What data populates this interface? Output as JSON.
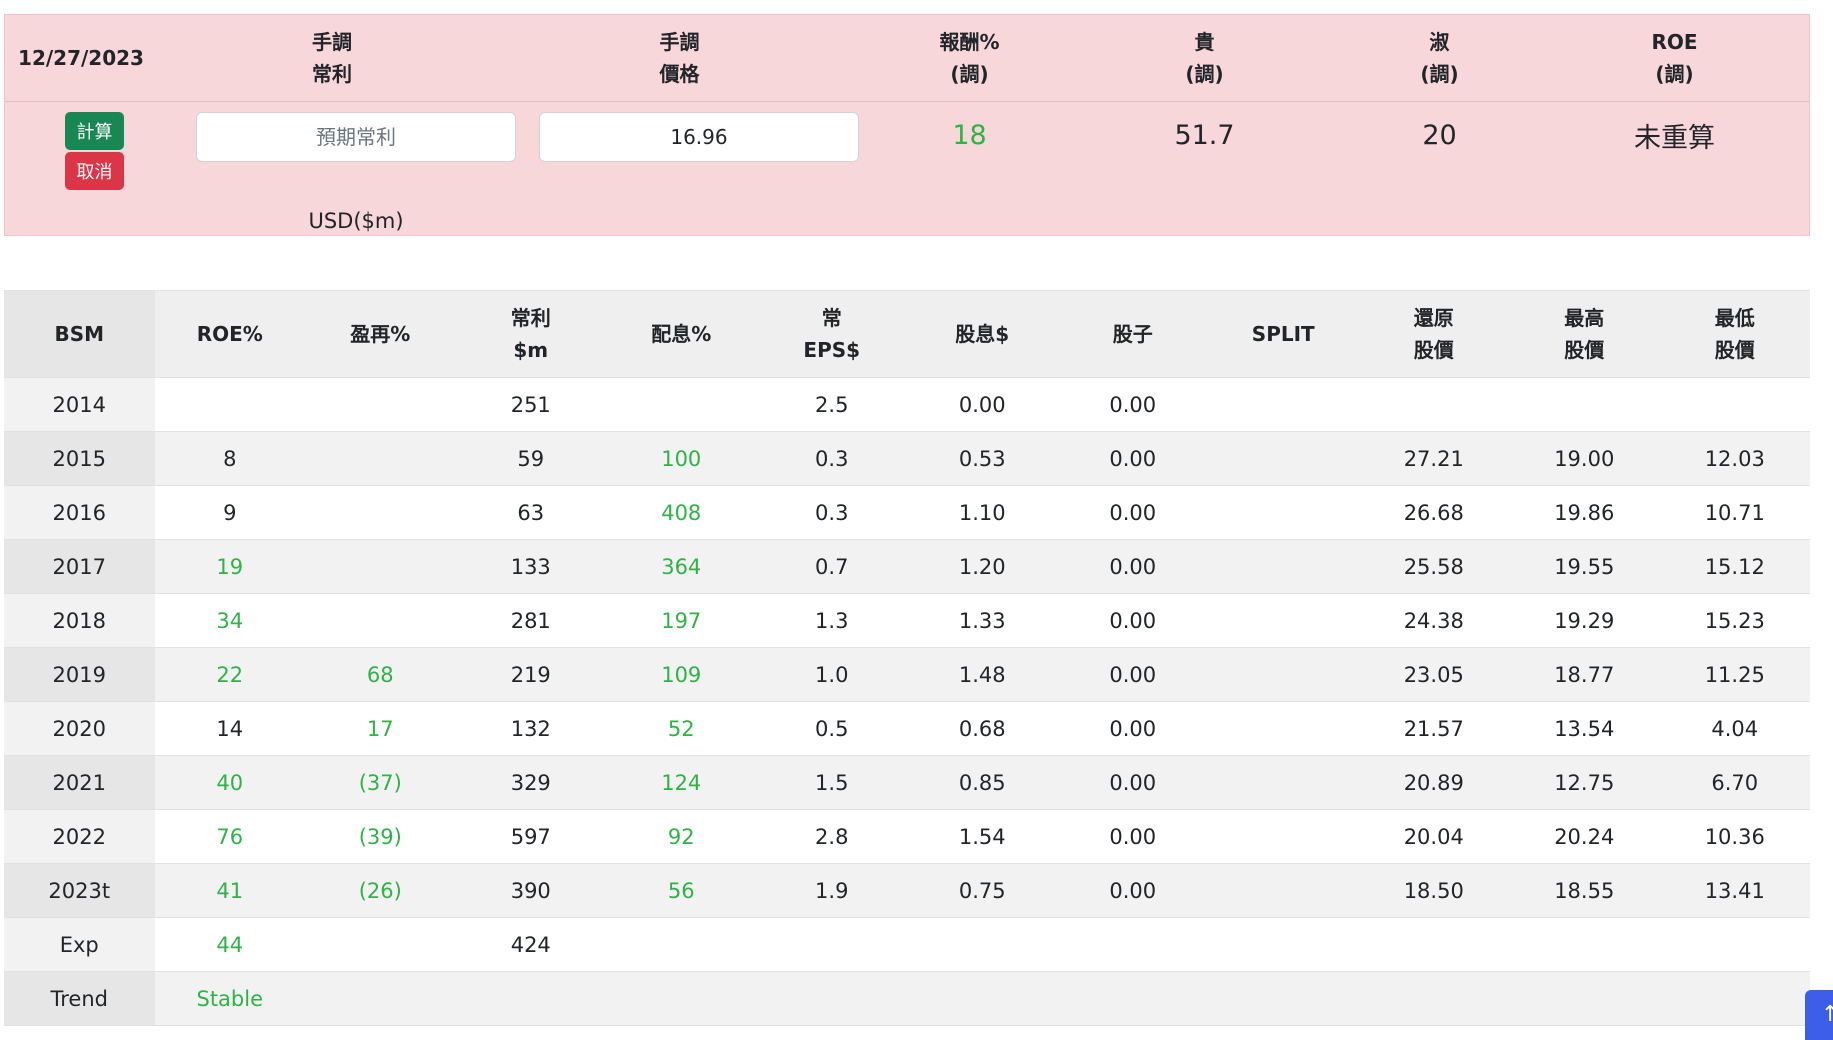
{
  "calc": {
    "headers": {
      "date": "12/27/2023",
      "adj_profit": [
        "手調",
        "常利"
      ],
      "adj_price": [
        "手調",
        "價格"
      ],
      "return": [
        "報酬%",
        "(調)"
      ],
      "expensive": [
        "貴",
        "(調)"
      ],
      "fair": [
        "淑",
        "(調)"
      ],
      "roe": [
        "ROE",
        "(調)"
      ]
    },
    "calc_button": "計算",
    "cancel_button": "取消",
    "profit_placeholder": "預期常利",
    "price_value": "16.96",
    "unit": "USD($m)",
    "return_value": "18",
    "expensive_value": "51.7",
    "fair_value": "20",
    "roe_value": "未重算"
  },
  "table": {
    "headers": [
      [
        "BSM"
      ],
      [
        "ROE%"
      ],
      [
        "盈再%"
      ],
      [
        "常利",
        "$m"
      ],
      [
        "配息%"
      ],
      [
        "常",
        "EPS$"
      ],
      [
        "股息$"
      ],
      [
        "股子"
      ],
      [
        "SPLIT"
      ],
      [
        "還原",
        "股價"
      ],
      [
        "最高",
        "股價"
      ],
      [
        "最低",
        "股價"
      ]
    ],
    "rows": [
      [
        "2014",
        "",
        "",
        "251",
        "",
        "2.5",
        "0.00",
        "0.00",
        "",
        "",
        "",
        ""
      ],
      [
        "2015",
        "8",
        "",
        "59",
        "100",
        "0.3",
        "0.53",
        "0.00",
        "",
        "27.21",
        "19.00",
        "12.03"
      ],
      [
        "2016",
        "9",
        "",
        "63",
        "408",
        "0.3",
        "1.10",
        "0.00",
        "",
        "26.68",
        "19.86",
        "10.71"
      ],
      [
        "2017",
        "19",
        "",
        "133",
        "364",
        "0.7",
        "1.20",
        "0.00",
        "",
        "25.58",
        "19.55",
        "15.12"
      ],
      [
        "2018",
        "34",
        "",
        "281",
        "197",
        "1.3",
        "1.33",
        "0.00",
        "",
        "24.38",
        "19.29",
        "15.23"
      ],
      [
        "2019",
        "22",
        "68",
        "219",
        "109",
        "1.0",
        "1.48",
        "0.00",
        "",
        "23.05",
        "18.77",
        "11.25"
      ],
      [
        "2020",
        "14",
        "17",
        "132",
        "52",
        "0.5",
        "0.68",
        "0.00",
        "",
        "21.57",
        "13.54",
        "4.04"
      ],
      [
        "2021",
        "40",
        "(37)",
        "329",
        "124",
        "1.5",
        "0.85",
        "0.00",
        "",
        "20.89",
        "12.75",
        "6.70"
      ],
      [
        "2022",
        "76",
        "(39)",
        "597",
        "92",
        "2.8",
        "1.54",
        "0.00",
        "",
        "20.04",
        "20.24",
        "10.36"
      ],
      [
        "2023t",
        "41",
        "(26)",
        "390",
        "56",
        "1.9",
        "0.75",
        "0.00",
        "",
        "18.50",
        "18.55",
        "13.41"
      ],
      [
        "Exp",
        "44",
        "",
        "424",
        "",
        "",
        "",
        "",
        "",
        "",
        "",
        ""
      ],
      [
        "Trend",
        "Stable",
        "",
        "",
        "",
        "",
        "",
        "",
        "",
        "",
        "",
        ""
      ]
    ],
    "green_cells": [
      [
        1,
        4
      ],
      [
        2,
        4
      ],
      [
        3,
        1
      ],
      [
        3,
        4
      ],
      [
        4,
        1
      ],
      [
        4,
        4
      ],
      [
        5,
        1
      ],
      [
        5,
        2
      ],
      [
        5,
        4
      ],
      [
        6,
        2
      ],
      [
        6,
        4
      ],
      [
        7,
        1
      ],
      [
        7,
        2
      ],
      [
        7,
        4
      ],
      [
        8,
        1
      ],
      [
        8,
        2
      ],
      [
        8,
        4
      ],
      [
        9,
        1
      ],
      [
        9,
        2
      ],
      [
        9,
        4
      ],
      [
        10,
        1
      ],
      [
        11,
        1
      ]
    ]
  },
  "colors": {
    "green": "#2fb344",
    "pink_panel": "#f8d7da",
    "calc_button": "#198754",
    "cancel_button": "#dc3545"
  },
  "icons": {
    "scroll_top": "arrow-up-icon"
  }
}
